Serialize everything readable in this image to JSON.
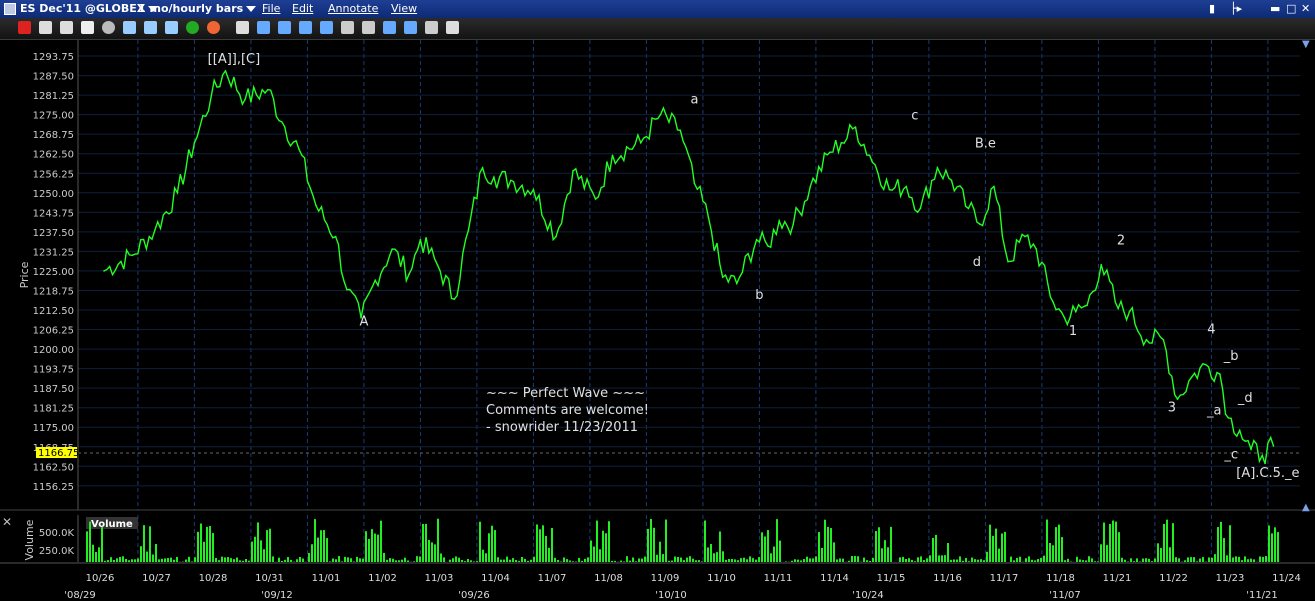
{
  "window": {
    "symbol": "ES Dec'11 @GLOBEX",
    "period": "1 mo/hourly bars",
    "menus": [
      "File",
      "Edit",
      "Annotate",
      "View"
    ]
  },
  "toolbar": {
    "icons": [
      "crosshair-icon",
      "print-icon",
      "grid-icon",
      "pie-icon",
      "circle-icon",
      "calc-icon",
      "chart-icon",
      "table-icon",
      "dollar-icon",
      "target-icon",
      "cursor-icon",
      "text-icon",
      "text-box-icon",
      "undo-icon",
      "redo-icon",
      "fib-icon",
      "lines-icon",
      "split-icon",
      "refresh-icon",
      "wrench-icon",
      "dropdown-icon"
    ]
  },
  "colors": {
    "price_line": "#22ff22",
    "volume_bar": "#22ee22",
    "grid": "#1c3d78",
    "last_price_bg": "#ffff00"
  },
  "price_panel": {
    "ylabel": "Price",
    "last_price": "1166.75",
    "yticks": [
      "1293.75",
      "1287.50",
      "1281.25",
      "1275.00",
      "1268.75",
      "1262.50",
      "1256.25",
      "1250.00",
      "1243.75",
      "1237.50",
      "1231.25",
      "1225.00",
      "1218.75",
      "1212.50",
      "1206.25",
      "1200.00",
      "1193.75",
      "1187.50",
      "1181.25",
      "1175.00",
      "1168.75",
      "1162.50",
      "1156.25"
    ]
  },
  "volume_panel": {
    "title": "Volume",
    "ylabel": "Volume",
    "yticks": [
      "500.0K",
      "250.0K"
    ]
  },
  "xaxis": {
    "dates": [
      "10/26",
      "10/27",
      "10/28",
      "10/31",
      "11/01",
      "11/02",
      "11/03",
      "11/04",
      "11/07",
      "11/08",
      "11/09",
      "11/10",
      "11/11",
      "11/14",
      "11/15",
      "11/16",
      "11/17",
      "11/18",
      "11/21",
      "11/22",
      "11/23",
      "11/24"
    ],
    "long_dates": [
      "'08/29",
      "'09/12",
      "'09/26",
      "'10/10",
      "'10/24",
      "'11/07",
      "'11/21"
    ]
  },
  "wave_labels": [
    {
      "text": "[[A]],[C]",
      "price": 1291.5,
      "t": 2.3
    },
    {
      "text": "A",
      "price": 1207.5,
      "t": 4.6
    },
    {
      "text": "a",
      "price": 1278.5,
      "t": 10.45
    },
    {
      "text": "b",
      "price": 1216.0,
      "t": 11.6
    },
    {
      "text": "c",
      "price": 1273.5,
      "t": 14.35
    },
    {
      "text": "B.e",
      "price": 1264.5,
      "t": 15.6
    },
    {
      "text": "d",
      "price": 1226.5,
      "t": 15.45
    },
    {
      "text": "1",
      "price": 1204.5,
      "t": 17.15
    },
    {
      "text": "2",
      "price": 1233.5,
      "t": 18.0
    },
    {
      "text": "3",
      "price": 1180.0,
      "t": 18.9
    },
    {
      "text": "4",
      "price": 1205.0,
      "t": 19.6
    },
    {
      "text": "_b",
      "price": 1196.5,
      "t": 19.95
    },
    {
      "text": "_a",
      "price": 1179.0,
      "t": 19.65
    },
    {
      "text": "_d",
      "price": 1183.0,
      "t": 20.2
    },
    {
      "text": "_c",
      "price": 1165.0,
      "t": 19.95
    },
    {
      "text": "[A].C.5._e",
      "price": 1159.0,
      "t": 20.6
    }
  ],
  "comments": [
    "~~~ Perfect Wave ~~~",
    "Comments are welcome!",
    "- snowrider  11/23/2011"
  ],
  "chart_data": {
    "type": "line",
    "title": "ES Dec'11 @GLOBEX",
    "xlabel": "",
    "ylabel": "Price",
    "ylim": [
      1153.0,
      1296.0
    ],
    "x": [
      0.0,
      0.5,
      0.9,
      1.3,
      1.6,
      1.9,
      2.15,
      2.5,
      2.9,
      3.2,
      3.45,
      3.75,
      4.1,
      4.3,
      4.55,
      4.8,
      5.1,
      5.4,
      5.6,
      5.9,
      6.2,
      6.45,
      6.7,
      6.9,
      7.2,
      7.6,
      8.0,
      8.3,
      8.7,
      9.0,
      9.5,
      9.85,
      10.2,
      10.45,
      10.7,
      10.95,
      11.2,
      11.55,
      11.75,
      11.95,
      12.2,
      12.5,
      12.85,
      13.05,
      13.3,
      13.55,
      13.9,
      14.2,
      14.45,
      14.75,
      15.0,
      15.3,
      15.5,
      15.75,
      16.0,
      16.3,
      16.5,
      16.8,
      17.0,
      17.2,
      17.4,
      17.65,
      17.95,
      18.15,
      18.45,
      18.75,
      19.0,
      19.25,
      19.5,
      19.75,
      19.9,
      20.1,
      20.3,
      20.5,
      20.7
    ],
    "series": [
      {
        "values": [
          1225,
          1230,
          1238,
          1250,
          1266,
          1281,
          1289,
          1280,
          1283,
          1271,
          1264,
          1246,
          1236,
          1219,
          1210,
          1222,
          1232,
          1224,
          1235,
          1227,
          1216,
          1238,
          1258,
          1255,
          1254,
          1251,
          1236,
          1257,
          1248,
          1262,
          1266,
          1275,
          1270,
          1253,
          1242,
          1223,
          1221,
          1235,
          1233,
          1241,
          1240,
          1252,
          1263,
          1266,
          1271,
          1262,
          1251,
          1252,
          1245,
          1258,
          1254,
          1245,
          1240,
          1252,
          1228,
          1236,
          1232,
          1215,
          1210,
          1212,
          1214,
          1227,
          1213,
          1212,
          1203,
          1203,
          1184,
          1191,
          1195,
          1192,
          1178,
          1174,
          1168,
          1166,
          1169
        ]
      }
    ]
  }
}
